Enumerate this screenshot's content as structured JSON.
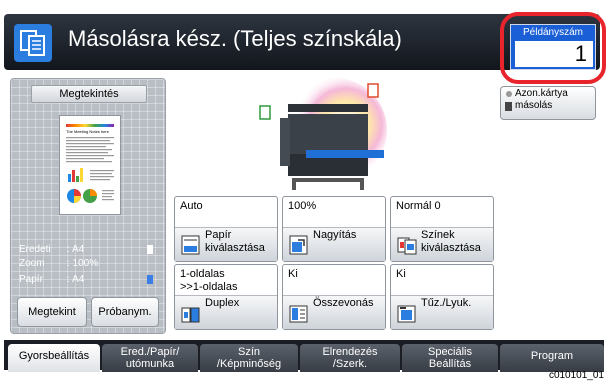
{
  "header": {
    "title": "Másolásra kész. (Teljes színskála)",
    "copies_label": "Példányszám",
    "copies_value": "1"
  },
  "preview": {
    "title": "Megtekintés",
    "doc_heading": "The Meeting Notes here",
    "rows": [
      {
        "label": "Eredeti",
        "value": ": A4"
      },
      {
        "label": "Zoom",
        "value": ": 100%"
      },
      {
        "label": "Papír",
        "value": ": A4"
      }
    ],
    "buttons": [
      "Megtekint",
      "Próbanym."
    ]
  },
  "id_card_button": {
    "line1": "Azon.kártya",
    "line2": "másolás"
  },
  "functions": [
    {
      "value_lines": [
        "Auto"
      ],
      "label_lines": [
        "Papír",
        "kiválasztása"
      ],
      "icon": "paper-select-icon"
    },
    {
      "value_lines": [
        "100%"
      ],
      "label_lines": [
        "Nagyítás"
      ],
      "icon": "zoom-icon"
    },
    {
      "value_lines": [
        "Normál 0"
      ],
      "label_lines": [
        "Színek",
        "kiválasztása"
      ],
      "icon": "color-select-icon"
    },
    {
      "value_lines": [
        "1-oldalas",
        ">>1-oldalas"
      ],
      "label_lines": [
        "Duplex"
      ],
      "icon": "duplex-icon"
    },
    {
      "value_lines": [
        "Ki"
      ],
      "label_lines": [
        "Összevonás"
      ],
      "icon": "combine-icon"
    },
    {
      "value_lines": [
        "Ki"
      ],
      "label_lines": [
        "Tűz./Lyuk."
      ],
      "icon": "staple-punch-icon"
    }
  ],
  "tabs": [
    {
      "lines": [
        "Gyorsbeállítás"
      ],
      "active": true
    },
    {
      "lines": [
        "Ered./Papír/",
        "utómunka"
      ],
      "active": false
    },
    {
      "lines": [
        "Szín",
        "/Képminőség"
      ],
      "active": false
    },
    {
      "lines": [
        "Elrendezés",
        "/Szerk."
      ],
      "active": false
    },
    {
      "lines": [
        "Speciális",
        "Beállítás"
      ],
      "active": false
    },
    {
      "lines": [
        "Program"
      ],
      "active": false
    }
  ],
  "image_code": "c010101_01",
  "colors": {
    "header_bg": "#1f242b",
    "accent_blue": "#1b5fd6",
    "highlight_red": "#e8242c"
  }
}
